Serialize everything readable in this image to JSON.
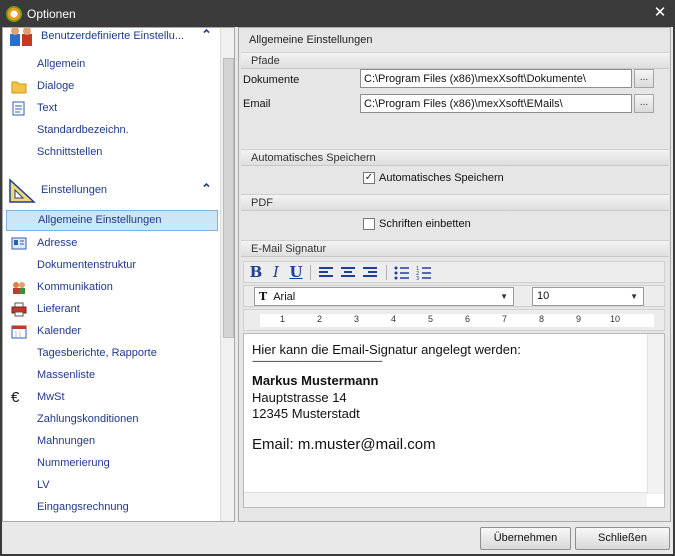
{
  "window": {
    "title": "Optionen"
  },
  "sidebar": {
    "group1": {
      "label": "Benutzerdefinierte Einstellu..."
    },
    "group1_items": [
      {
        "label": "Allgemein",
        "icon": ""
      },
      {
        "label": "Dialoge",
        "icon": "folder-icon"
      },
      {
        "label": "Text",
        "icon": "text-document-icon"
      },
      {
        "label": "Standardbezeichn.",
        "icon": ""
      },
      {
        "label": "Schnittstellen",
        "icon": ""
      }
    ],
    "group2": {
      "label": "Einstellungen"
    },
    "group2_items": [
      {
        "label": "Allgemeine Einstellungen",
        "icon": ""
      },
      {
        "label": "Adresse",
        "icon": "address-card-icon"
      },
      {
        "label": "Dokumentenstruktur",
        "icon": ""
      },
      {
        "label": "Kommunikation",
        "icon": "people-icon"
      },
      {
        "label": "Lieferant",
        "icon": "printer-icon"
      },
      {
        "label": "Kalender",
        "icon": "calendar-icon"
      },
      {
        "label": "Tagesberichte, Rapporte",
        "icon": ""
      },
      {
        "label": "Massenliste",
        "icon": ""
      },
      {
        "label": "MwSt",
        "icon": "euro-icon"
      },
      {
        "label": "Zahlungskonditionen",
        "icon": ""
      },
      {
        "label": "Mahnungen",
        "icon": ""
      },
      {
        "label": "Nummerierung",
        "icon": ""
      },
      {
        "label": "LV",
        "icon": ""
      },
      {
        "label": "Eingangsrechnung",
        "icon": ""
      }
    ]
  },
  "main": {
    "title": "Allgemeine Einstellungen",
    "paths": {
      "header": "Pfade",
      "documents_label": "Dokumente",
      "documents_value": "C:\\Program Files (x86)\\mexXsoft\\Dokumente\\",
      "email_label": "Email",
      "email_value": "C:\\Program Files (x86)\\mexXsoft\\EMails\\",
      "browse_label": "..."
    },
    "autosave": {
      "header": "Automatisches Speichern",
      "checkbox_label": "Automatisches Speichern",
      "checked": true
    },
    "pdf": {
      "header": "PDF",
      "checkbox_label": "Schriften einbetten",
      "checked": false
    },
    "signature": {
      "header": "E-Mail Signatur",
      "toolbar": {
        "bold": "B",
        "italic": "I",
        "underline": "U"
      },
      "font": "Arial",
      "font_size": "10",
      "ruler_numbers": [
        "1",
        "2",
        "3",
        "4",
        "5",
        "6",
        "7",
        "8",
        "9",
        "10"
      ],
      "lines": [
        "Hier kann die Email-Signatur angelegt werden:",
        "-----------------------------------------------------------------",
        "Markus Mustermann",
        "Hauptstrasse 14",
        "12345 Musterstadt",
        "Email: m.muster@mail.com"
      ]
    }
  },
  "buttons": {
    "apply": "Übernehmen",
    "close": "Schließen"
  }
}
